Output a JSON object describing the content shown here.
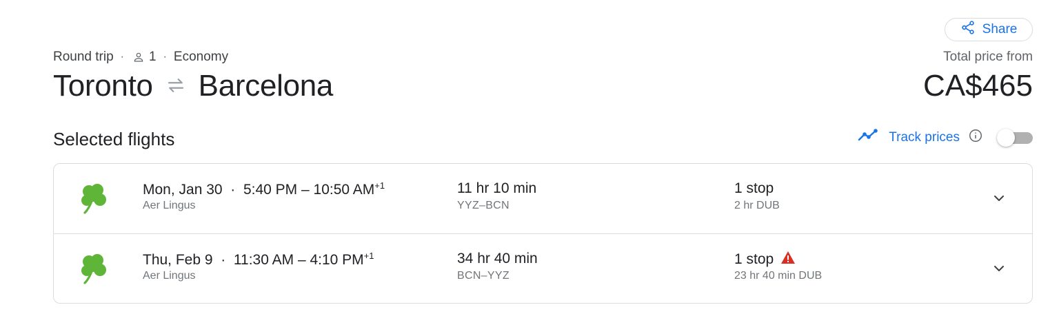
{
  "share": {
    "label": "Share",
    "icon": "share-icon"
  },
  "trip": {
    "type": "Round trip",
    "passengers": "1",
    "cabin": "Economy",
    "origin": "Toronto",
    "destination": "Barcelona"
  },
  "price": {
    "label": "Total price from",
    "value": "CA$465"
  },
  "section": {
    "title": "Selected flights"
  },
  "track": {
    "label": "Track prices",
    "enabled": false
  },
  "colors": {
    "accent": "#1a73e8",
    "warning": "#d93025",
    "logo": "#5fb537"
  },
  "flights": [
    {
      "date": "Mon, Jan 30",
      "depart": "5:40 PM",
      "arrive": "10:50 AM",
      "day_offset": "+1",
      "airline": "Aer Lingus",
      "duration": "11 hr 10 min",
      "airports": "YYZ–BCN",
      "stops": "1 stop",
      "warning": false,
      "layover": "2 hr DUB"
    },
    {
      "date": "Thu, Feb 9",
      "depart": "11:30 AM",
      "arrive": "4:10 PM",
      "day_offset": "+1",
      "airline": "Aer Lingus",
      "duration": "34 hr 40 min",
      "airports": "BCN–YYZ",
      "stops": "1 stop",
      "warning": true,
      "layover": "23 hr 40 min DUB"
    }
  ]
}
